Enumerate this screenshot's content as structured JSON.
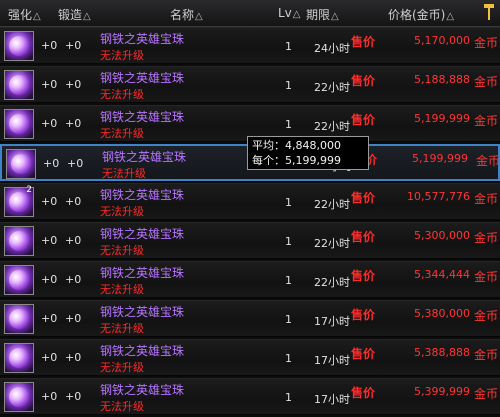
{
  "header": {
    "cols": [
      "强化",
      "锻造",
      "名称",
      "Lv",
      "期限",
      "价格(金币)"
    ]
  },
  "rows": [
    {
      "plus1": "+0",
      "plus2": "+0",
      "name": "钢铁之英雄宝珠",
      "sub": "无法升级",
      "lv": "1",
      "duration": "24小时",
      "sell": "售价",
      "price": "5,170,000",
      "currency": "金币",
      "count": ""
    },
    {
      "plus1": "+0",
      "plus2": "+0",
      "name": "钢铁之英雄宝珠",
      "sub": "无法升级",
      "lv": "1",
      "duration": "22小时",
      "sell": "售价",
      "price": "5,188,888",
      "currency": "金币",
      "count": ""
    },
    {
      "plus1": "+0",
      "plus2": "+0",
      "name": "钢铁之英雄宝珠",
      "sub": "无法升级",
      "lv": "1",
      "duration": "22小时",
      "sell": "售价",
      "price": "5,199,999",
      "currency": "金币",
      "count": ""
    },
    {
      "plus1": "+0",
      "plus2": "+0",
      "name": "钢铁之英雄宝珠",
      "sub": "无法升级",
      "lv": "1",
      "duration": "22小时",
      "sell": "售价",
      "price": "5,199,999",
      "currency": "金币",
      "count": ""
    },
    {
      "plus1": "+0",
      "plus2": "+0",
      "name": "钢铁之英雄宝珠",
      "sub": "无法升级",
      "lv": "1",
      "duration": "22小时",
      "sell": "售价",
      "price": "10,577,776",
      "currency": "金币",
      "count": "2"
    },
    {
      "plus1": "+0",
      "plus2": "+0",
      "name": "钢铁之英雄宝珠",
      "sub": "无法升级",
      "lv": "1",
      "duration": "22小时",
      "sell": "售价",
      "price": "5,300,000",
      "currency": "金币",
      "count": ""
    },
    {
      "plus1": "+0",
      "plus2": "+0",
      "name": "钢铁之英雄宝珠",
      "sub": "无法升级",
      "lv": "1",
      "duration": "22小时",
      "sell": "售价",
      "price": "5,344,444",
      "currency": "金币",
      "count": ""
    },
    {
      "plus1": "+0",
      "plus2": "+0",
      "name": "钢铁之英雄宝珠",
      "sub": "无法升级",
      "lv": "1",
      "duration": "17小时",
      "sell": "售价",
      "price": "5,380,000",
      "currency": "金币",
      "count": ""
    },
    {
      "plus1": "+0",
      "plus2": "+0",
      "name": "钢铁之英雄宝珠",
      "sub": "无法升级",
      "lv": "1",
      "duration": "17小时",
      "sell": "售价",
      "price": "5,388,888",
      "currency": "金币",
      "count": ""
    },
    {
      "plus1": "+0",
      "plus2": "+0",
      "name": "钢铁之英雄宝珠",
      "sub": "无法升级",
      "lv": "1",
      "duration": "17小时",
      "sell": "售价",
      "price": "5,399,999",
      "currency": "金币",
      "count": ""
    }
  ],
  "selected_row": 3,
  "tooltip": {
    "avg_label": "平均：4,848,000",
    "each_label": "每个：5,199,999"
  },
  "colors": {
    "name": "#b774ff",
    "warning": "#ff2a2a",
    "price": "#ff3535",
    "selection": "#3f83c9"
  },
  "icons": {
    "item": "purple-orb-icon",
    "pin": "pin-icon"
  }
}
